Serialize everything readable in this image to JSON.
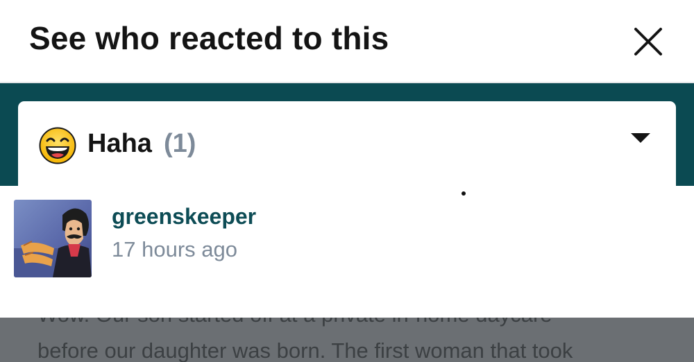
{
  "dialog": {
    "title": "See who reacted to this",
    "close_icon": "close-icon"
  },
  "reaction_filter": {
    "icon": "haha-emoji-icon",
    "name": "Haha",
    "count": "(1)",
    "arrow_icon": "caret-down-icon"
  },
  "reactors": [
    {
      "username": "greenskeeper",
      "time": "17 hours ago",
      "avatar_icon": "cartoon-avatar"
    }
  ],
  "background_post": {
    "line_cut": "Wow. Our son started off at a private in-home daycare",
    "line_full": "before our daughter was born. The first woman that took"
  },
  "colors": {
    "teal": "#0b4a52",
    "username": "#0d4c55",
    "muted": "#7d8a99",
    "title": "#141414"
  }
}
